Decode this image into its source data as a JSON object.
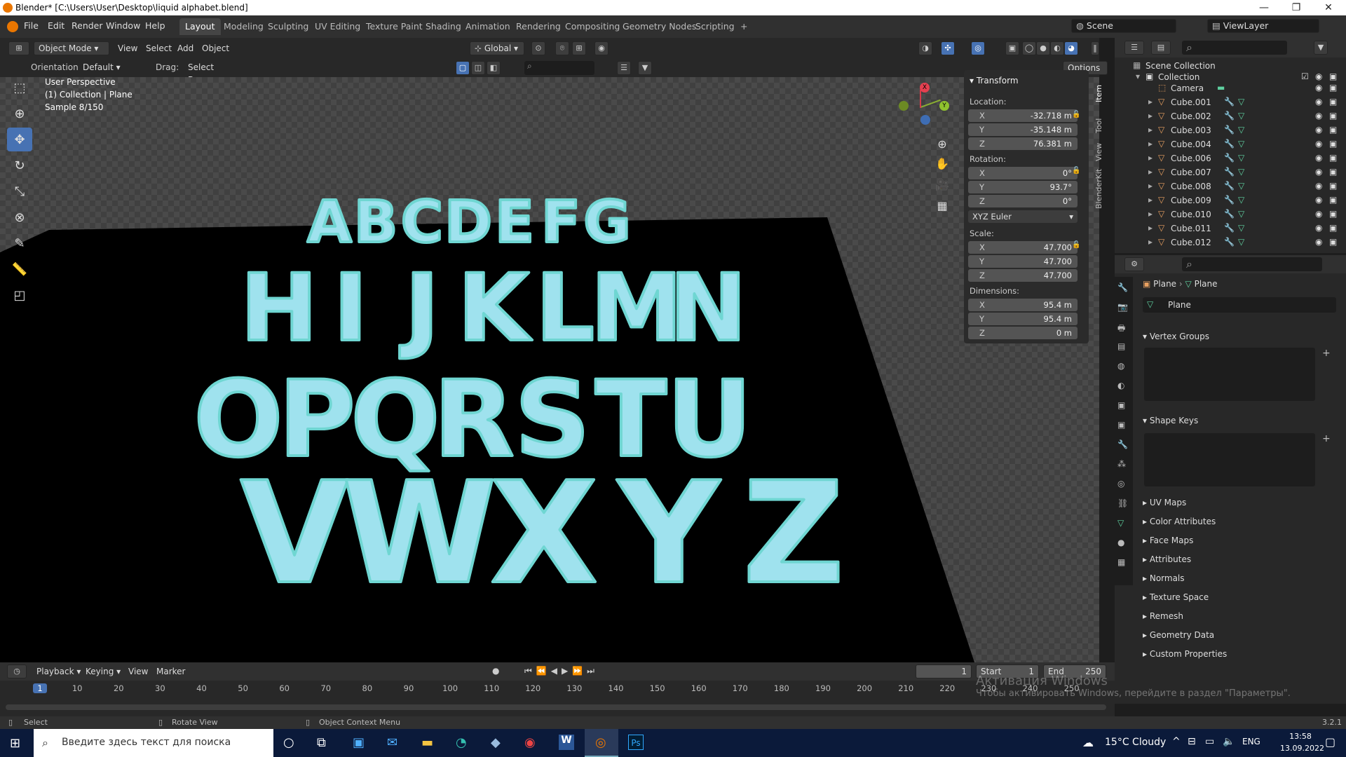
{
  "window": {
    "title": "Blender* [C:\\Users\\User\\Desktop\\liquid alphabet.blend]",
    "minimize": "—",
    "maximize": "❐",
    "close": "✕"
  },
  "topbar": {
    "menus": [
      "File",
      "Edit",
      "Render",
      "Window",
      "Help"
    ],
    "workspaces": [
      "Layout",
      "Modeling",
      "Sculpting",
      "UV Editing",
      "Texture Paint",
      "Shading",
      "Animation",
      "Rendering",
      "Compositing",
      "Geometry Nodes",
      "Scripting"
    ],
    "add_tab": "+",
    "scene": "Scene",
    "view_layer": "ViewLayer"
  },
  "viewport_header": {
    "mode": "Object Mode",
    "menus": [
      "View",
      "Select",
      "Add",
      "Object"
    ],
    "transform_orientation": "Global",
    "options": "Options"
  },
  "tool_settings": {
    "orientation_label": "Orientation:",
    "orientation_value": "Default",
    "drag_label": "Drag:",
    "drag_value": "Select Box"
  },
  "viewport": {
    "perspective": "User Perspective",
    "collection_info": "(1) Collection | Plane",
    "sample": "Sample 8/150",
    "scene_letters": [
      "ABCDEFG",
      "HIJKLMN",
      "OPQRSTU",
      "VWXYZ"
    ],
    "letter_color": "#9fe2ee"
  },
  "gizmo": {
    "x": "X",
    "y": "Y",
    "z": "Z"
  },
  "n_panel": {
    "title": "Transform",
    "location_label": "Location:",
    "location": [
      {
        "axis": "X",
        "value": "-32.718 m"
      },
      {
        "axis": "Y",
        "value": "-35.148 m"
      },
      {
        "axis": "Z",
        "value": "76.381 m"
      }
    ],
    "rotation_label": "Rotation:",
    "rotation": [
      {
        "axis": "X",
        "value": "0°"
      },
      {
        "axis": "Y",
        "value": "93.7°"
      },
      {
        "axis": "Z",
        "value": "0°"
      }
    ],
    "rotation_mode": "XYZ Euler",
    "scale_label": "Scale:",
    "scale": [
      {
        "axis": "X",
        "value": "47.700"
      },
      {
        "axis": "Y",
        "value": "47.700"
      },
      {
        "axis": "Z",
        "value": "47.700"
      }
    ],
    "dimensions_label": "Dimensions:",
    "dimensions": [
      {
        "axis": "X",
        "value": "95.4 m"
      },
      {
        "axis": "Y",
        "value": "95.4 m"
      },
      {
        "axis": "Z",
        "value": "0 m"
      }
    ],
    "tabs": [
      "Item",
      "Tool",
      "View",
      "BlenderKit"
    ]
  },
  "outliner": {
    "scene_collection": "Scene Collection",
    "collection": "Collection",
    "items": [
      "Camera",
      "Cube.001",
      "Cube.002",
      "Cube.003",
      "Cube.004",
      "Cube.006",
      "Cube.007",
      "Cube.008",
      "Cube.009",
      "Cube.010",
      "Cube.011",
      "Cube.012"
    ]
  },
  "properties": {
    "breadcrumb_object": "Plane",
    "breadcrumb_data": "Plane",
    "mesh_name": "Plane",
    "vertex_groups": "Vertex Groups",
    "shape_keys": "Shape Keys",
    "sections": [
      "UV Maps",
      "Color Attributes",
      "Face Maps",
      "Attributes",
      "Normals",
      "Texture Space",
      "Remesh",
      "Geometry Data",
      "Custom Properties"
    ]
  },
  "timeline": {
    "menus": [
      "Playback",
      "Keying",
      "View",
      "Marker"
    ],
    "current_frame": "1",
    "start_label": "Start",
    "start_value": "1",
    "end_label": "End",
    "end_value": "250",
    "ticks": [
      "1",
      "10",
      "20",
      "30",
      "40",
      "50",
      "60",
      "70",
      "80",
      "90",
      "100",
      "110",
      "120",
      "130",
      "140",
      "150",
      "160",
      "170",
      "180",
      "190",
      "200",
      "210",
      "220",
      "230",
      "240",
      "250"
    ],
    "activation_title": "Активация Windows",
    "activation_text": "Чтобы активировать Windows, перейдите в раздел \"Параметры\"."
  },
  "statusbar": {
    "select": "Select",
    "rotate": "Rotate View",
    "context": "Object Context Menu",
    "version": "3.2.1"
  },
  "taskbar": {
    "search_placeholder": "Введите здесь текст для поиска",
    "weather": "15°C Cloudy",
    "language": "ENG",
    "time": "13:58",
    "date": "13.09.2022"
  }
}
